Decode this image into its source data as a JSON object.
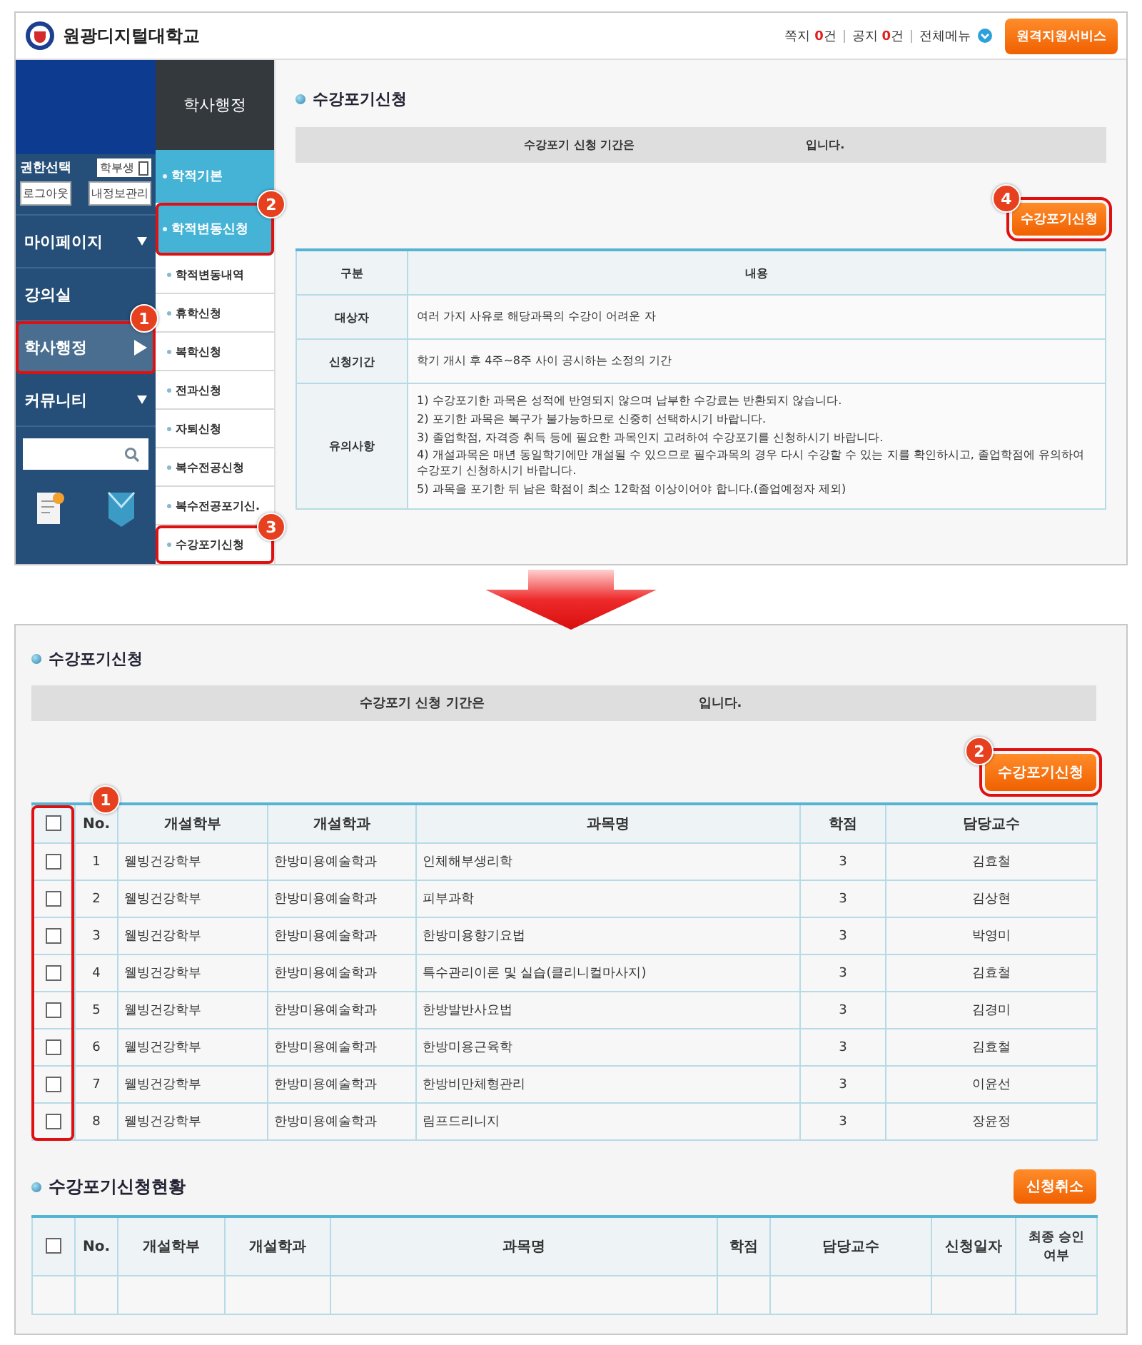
{
  "top_screen": {
    "header": {
      "logo_text": "원광디지털대학교",
      "links": [
        {
          "label": "쪽지",
          "count": "0",
          "unit": "건"
        },
        {
          "label": "공지",
          "count": "0",
          "unit": "건"
        },
        {
          "label": "전체메뉴"
        }
      ],
      "button": "원격지원서비스"
    },
    "sidebar": {
      "role_label": "권한선택",
      "role_value": "학부생",
      "buttons": [
        "로그아웃",
        "내정보관리"
      ],
      "menu": [
        {
          "label": "마이페이지",
          "kind": "dropdown",
          "selected": false
        },
        {
          "label": "강의실",
          "kind": "plain",
          "selected": false
        },
        {
          "label": "학사행정",
          "kind": "arrow",
          "selected": true,
          "callout": "1"
        },
        {
          "label": "커뮤니티",
          "kind": "dropdown",
          "selected": false
        }
      ]
    },
    "submenu": {
      "title": "학사행정",
      "items": [
        {
          "label": "학적기본",
          "kind": "group"
        },
        {
          "label": "학적변동신청",
          "kind": "group",
          "callout": "2"
        },
        {
          "label": "학적변동내역",
          "kind": "item"
        },
        {
          "label": "휴학신청",
          "kind": "item"
        },
        {
          "label": "복학신청",
          "kind": "item"
        },
        {
          "label": "전과신청",
          "kind": "item"
        },
        {
          "label": "자퇴신청",
          "kind": "item"
        },
        {
          "label": "복수전공신청",
          "kind": "item"
        },
        {
          "label": "복수전공포기신.",
          "kind": "item"
        },
        {
          "label": "수강포기신청",
          "kind": "item",
          "callout": "3"
        }
      ]
    },
    "main": {
      "title": "수강포기신청",
      "notice_start": "수강포기 신청 기간은",
      "notice_end": "입니다.",
      "button": "수강포기신청",
      "button_callout": "4",
      "info_table": {
        "columns": [
          "구분",
          "내용"
        ],
        "rows": [
          {
            "label": "대상자",
            "lines": [
              "여러 가지 사유로 해당과목의 수강이 어려운 자"
            ]
          },
          {
            "label": "신청기간",
            "lines": [
              "학기 개시 후 4주~8주 사이 공시하는 소정의 기간"
            ]
          },
          {
            "label": "유의사항",
            "lines": [
              "1) 수강포기한 과목은 성적에 반영되지 않으며 납부한 수강료는 반환되지 않습니다.",
              "2) 포기한 과목은 복구가 불가능하므로 신중히 선택하시기 바랍니다.",
              "3) 졸업학점, 자격증 취득 등에 필요한 과목인지 고려하여 수강포기를 신청하시기 바랍니다.",
              "4) 개설과목은 매년 동일학기에만 개설될 수 있으므로 필수과목의 경우 다시 수강할 수 있는 지를 확인하시고, 졸업학점에 유의하여 수강포기 신청하시기 바랍니다.",
              "5) 과목을 포기한 뒤 남은 학점이 최소 12학점 이상이어야 합니다.(졸업예정자 제외)"
            ]
          }
        ]
      }
    }
  },
  "bottom_screen": {
    "title": "수강포기신청",
    "notice_start": "수강포기 신청 기간은",
    "notice_end": "입니다.",
    "button": "수강포기신청",
    "button_callout": "2",
    "course_table": {
      "checkbox_callout": "1",
      "header_checked": false,
      "columns": [
        "No.",
        "개설학부",
        "개설학과",
        "과목명",
        "학점",
        "담당교수"
      ],
      "rows": [
        {
          "checked": false,
          "cells": [
            "1",
            "웰빙건강학부",
            "한방미용예술학과",
            "인체해부생리학",
            "3",
            "김효철"
          ]
        },
        {
          "checked": false,
          "cells": [
            "2",
            "웰빙건강학부",
            "한방미용예술학과",
            "피부과학",
            "3",
            "김상현"
          ]
        },
        {
          "checked": false,
          "cells": [
            "3",
            "웰빙건강학부",
            "한방미용예술학과",
            "한방미용향기요법",
            "3",
            "박영미"
          ]
        },
        {
          "checked": false,
          "cells": [
            "4",
            "웰빙건강학부",
            "한방미용예술학과",
            "특수관리이론 및 실습(클리니컬마사지)",
            "3",
            "김효철"
          ]
        },
        {
          "checked": false,
          "cells": [
            "5",
            "웰빙건강학부",
            "한방미용예술학과",
            "한방발반사요법",
            "3",
            "김경미"
          ]
        },
        {
          "checked": false,
          "cells": [
            "6",
            "웰빙건강학부",
            "한방미용예술학과",
            "한방미용근육학",
            "3",
            "김효철"
          ]
        },
        {
          "checked": false,
          "cells": [
            "7",
            "웰빙건강학부",
            "한방미용예술학과",
            "한방비만체형관리",
            "3",
            "이윤선"
          ]
        },
        {
          "checked": false,
          "cells": [
            "8",
            "웰빙건강학부",
            "한방미용예술학과",
            "림프드리니지",
            "3",
            "장윤정"
          ]
        }
      ]
    },
    "status_title": "수강포기신청현황",
    "cancel_button": "신청취소",
    "status_table": {
      "header_checked": false,
      "columns": [
        "No.",
        "개설학부",
        "개설학과",
        "과목명",
        "학점",
        "담당교수",
        "신청일자",
        "최종 승인여부"
      ]
    }
  }
}
